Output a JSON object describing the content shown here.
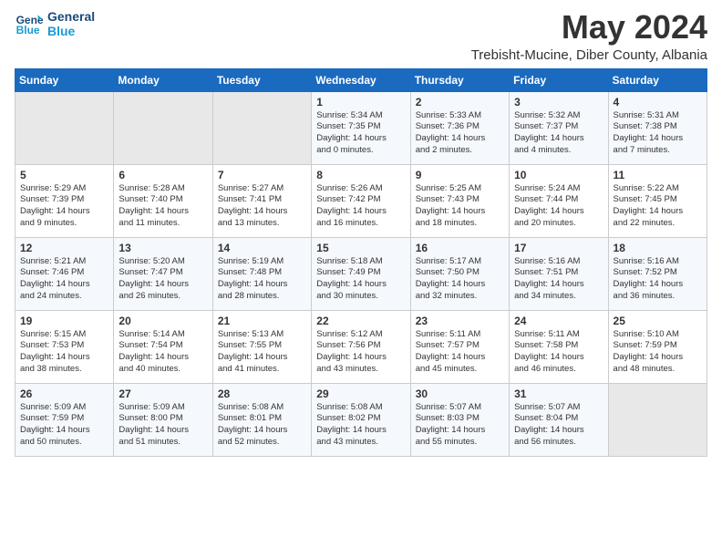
{
  "header": {
    "logo_line1": "General",
    "logo_line2": "Blue",
    "month": "May 2024",
    "location": "Trebisht-Mucine, Diber County, Albania"
  },
  "weekdays": [
    "Sunday",
    "Monday",
    "Tuesday",
    "Wednesday",
    "Thursday",
    "Friday",
    "Saturday"
  ],
  "weeks": [
    [
      {
        "day": "",
        "info": ""
      },
      {
        "day": "",
        "info": ""
      },
      {
        "day": "",
        "info": ""
      },
      {
        "day": "1",
        "info": "Sunrise: 5:34 AM\nSunset: 7:35 PM\nDaylight: 14 hours\nand 0 minutes."
      },
      {
        "day": "2",
        "info": "Sunrise: 5:33 AM\nSunset: 7:36 PM\nDaylight: 14 hours\nand 2 minutes."
      },
      {
        "day": "3",
        "info": "Sunrise: 5:32 AM\nSunset: 7:37 PM\nDaylight: 14 hours\nand 4 minutes."
      },
      {
        "day": "4",
        "info": "Sunrise: 5:31 AM\nSunset: 7:38 PM\nDaylight: 14 hours\nand 7 minutes."
      }
    ],
    [
      {
        "day": "5",
        "info": "Sunrise: 5:29 AM\nSunset: 7:39 PM\nDaylight: 14 hours\nand 9 minutes."
      },
      {
        "day": "6",
        "info": "Sunrise: 5:28 AM\nSunset: 7:40 PM\nDaylight: 14 hours\nand 11 minutes."
      },
      {
        "day": "7",
        "info": "Sunrise: 5:27 AM\nSunset: 7:41 PM\nDaylight: 14 hours\nand 13 minutes."
      },
      {
        "day": "8",
        "info": "Sunrise: 5:26 AM\nSunset: 7:42 PM\nDaylight: 14 hours\nand 16 minutes."
      },
      {
        "day": "9",
        "info": "Sunrise: 5:25 AM\nSunset: 7:43 PM\nDaylight: 14 hours\nand 18 minutes."
      },
      {
        "day": "10",
        "info": "Sunrise: 5:24 AM\nSunset: 7:44 PM\nDaylight: 14 hours\nand 20 minutes."
      },
      {
        "day": "11",
        "info": "Sunrise: 5:22 AM\nSunset: 7:45 PM\nDaylight: 14 hours\nand 22 minutes."
      }
    ],
    [
      {
        "day": "12",
        "info": "Sunrise: 5:21 AM\nSunset: 7:46 PM\nDaylight: 14 hours\nand 24 minutes."
      },
      {
        "day": "13",
        "info": "Sunrise: 5:20 AM\nSunset: 7:47 PM\nDaylight: 14 hours\nand 26 minutes."
      },
      {
        "day": "14",
        "info": "Sunrise: 5:19 AM\nSunset: 7:48 PM\nDaylight: 14 hours\nand 28 minutes."
      },
      {
        "day": "15",
        "info": "Sunrise: 5:18 AM\nSunset: 7:49 PM\nDaylight: 14 hours\nand 30 minutes."
      },
      {
        "day": "16",
        "info": "Sunrise: 5:17 AM\nSunset: 7:50 PM\nDaylight: 14 hours\nand 32 minutes."
      },
      {
        "day": "17",
        "info": "Sunrise: 5:16 AM\nSunset: 7:51 PM\nDaylight: 14 hours\nand 34 minutes."
      },
      {
        "day": "18",
        "info": "Sunrise: 5:16 AM\nSunset: 7:52 PM\nDaylight: 14 hours\nand 36 minutes."
      }
    ],
    [
      {
        "day": "19",
        "info": "Sunrise: 5:15 AM\nSunset: 7:53 PM\nDaylight: 14 hours\nand 38 minutes."
      },
      {
        "day": "20",
        "info": "Sunrise: 5:14 AM\nSunset: 7:54 PM\nDaylight: 14 hours\nand 40 minutes."
      },
      {
        "day": "21",
        "info": "Sunrise: 5:13 AM\nSunset: 7:55 PM\nDaylight: 14 hours\nand 41 minutes."
      },
      {
        "day": "22",
        "info": "Sunrise: 5:12 AM\nSunset: 7:56 PM\nDaylight: 14 hours\nand 43 minutes."
      },
      {
        "day": "23",
        "info": "Sunrise: 5:11 AM\nSunset: 7:57 PM\nDaylight: 14 hours\nand 45 minutes."
      },
      {
        "day": "24",
        "info": "Sunrise: 5:11 AM\nSunset: 7:58 PM\nDaylight: 14 hours\nand 46 minutes."
      },
      {
        "day": "25",
        "info": "Sunrise: 5:10 AM\nSunset: 7:59 PM\nDaylight: 14 hours\nand 48 minutes."
      }
    ],
    [
      {
        "day": "26",
        "info": "Sunrise: 5:09 AM\nSunset: 7:59 PM\nDaylight: 14 hours\nand 50 minutes."
      },
      {
        "day": "27",
        "info": "Sunrise: 5:09 AM\nSunset: 8:00 PM\nDaylight: 14 hours\nand 51 minutes."
      },
      {
        "day": "28",
        "info": "Sunrise: 5:08 AM\nSunset: 8:01 PM\nDaylight: 14 hours\nand 52 minutes."
      },
      {
        "day": "29",
        "info": "Sunrise: 5:08 AM\nSunset: 8:02 PM\nDaylight: 14 hours\nand 43 minutes."
      },
      {
        "day": "30",
        "info": "Sunrise: 5:07 AM\nSunset: 8:03 PM\nDaylight: 14 hours\nand 55 minutes."
      },
      {
        "day": "31",
        "info": "Sunrise: 5:07 AM\nSunset: 8:04 PM\nDaylight: 14 hours\nand 56 minutes."
      },
      {
        "day": "",
        "info": ""
      }
    ]
  ]
}
